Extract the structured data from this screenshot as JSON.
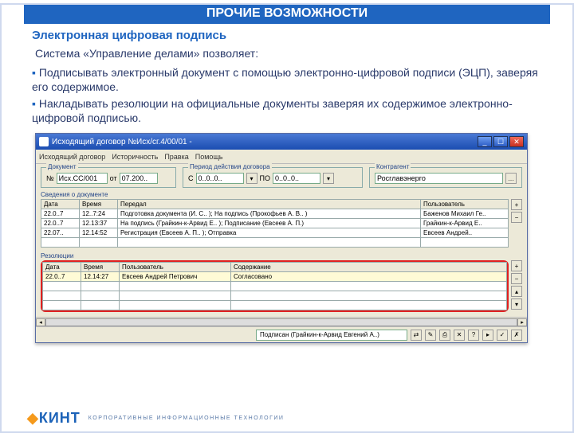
{
  "slide": {
    "header": "ПРОЧИЕ ВОЗМОЖНОСТИ",
    "subtitle": "Электронная цифровая подпись",
    "lead": "Система «Управление делами» позволяет:",
    "bullets": [
      "Подписывать электронный документ с помощью электронно-цифровой подписи (ЭЦП), заверяя его содержимое.",
      "Накладывать резолюции на официальные документы заверяя их содержимое электронно-цифровой подписью."
    ]
  },
  "app": {
    "title": "Исходящий договор №Исх/сг.4/00/01 -",
    "menu": [
      "Исходящий договор",
      "Историчность",
      "Правка",
      "Помощь"
    ],
    "doc": {
      "legend": "Документ",
      "num_lbl": "№",
      "num": "Исх.СС/001",
      "date_lbl": "от",
      "date": "07.200.."
    },
    "period": {
      "legend": "Период действия договора",
      "from_lbl": "С",
      "from": "0..0..0..",
      "to_lbl": "ПО",
      "to": "0..0..0.."
    },
    "partner": {
      "legend": "Контрагент",
      "value": "Росглавэнерго"
    },
    "reg_table": {
      "legend": "Сведения о документе",
      "cols": [
        "Дата",
        "Время",
        "Передал",
        "Пользователь"
      ],
      "rows": [
        [
          "22.0..7",
          "12..7:24",
          "Подготовка документа (И. С.. ); На подпись (Прокофьев А. В.. )",
          "Баженов Михаил Ге.."
        ],
        [
          "22.0..7",
          "12.13:37",
          "На подпись (Грайкин-к-Арвид Е.. ); Подписание (Евсеев А. П.)",
          "Грайкин-к-Арвид Е.."
        ],
        [
          "22.07..",
          "12.14:52",
          "Регистрация (Евсеев А. П.. ); Отправка",
          "Евсеев Андрей.."
        ]
      ]
    },
    "resol_table": {
      "legend": "Резолюции",
      "cols": [
        "Дата",
        "Время",
        "Пользователь",
        "Содержание"
      ],
      "rows": [
        [
          "22.0..7",
          "12.14:27",
          "Евсеев Андрей Петрович",
          "Согласовано"
        ]
      ]
    },
    "status": {
      "field": "Подписан (Грайкин-к-Арвид Евгений А..)"
    }
  },
  "brand": {
    "name": "КИНТ",
    "tag": "КОРПОРАТИВНЫЕ ИНФОРМАЦИОННЫЕ ТЕХНОЛОГИИ"
  }
}
